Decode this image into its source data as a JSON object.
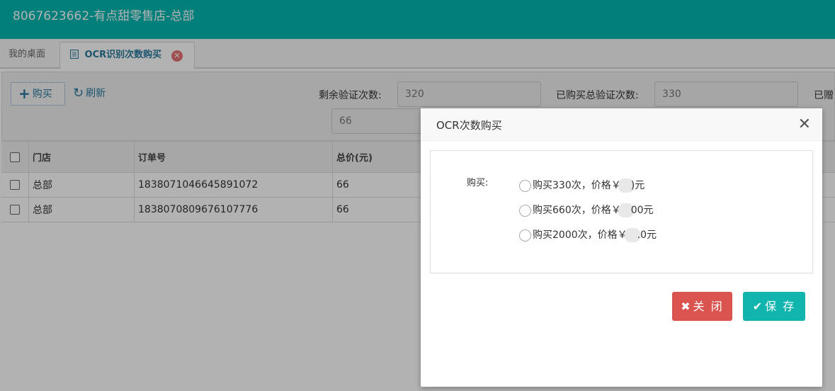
{
  "header": {
    "title": "8067623662-有点甜零售店-总部"
  },
  "tabs": [
    {
      "label": "我的桌面"
    },
    {
      "label": "OCR识别次数购买"
    }
  ],
  "toolbar": {
    "buy_label": "购买",
    "refresh_label": "刷新",
    "remaining_label": "剩余验证次数:",
    "remaining_value": "320",
    "total_label": "已购买总验证次数:",
    "total_value": "330",
    "gift_label": "已赠",
    "extra_value": "66"
  },
  "table": {
    "headers": [
      "门店",
      "订单号",
      "总价(元)"
    ],
    "rows": [
      {
        "store": "总部",
        "order": "1838071046645891072",
        "price": "66"
      },
      {
        "store": "总部",
        "order": "1838070809676107776",
        "price": "66"
      }
    ]
  },
  "dialog": {
    "title": "OCR次数购买",
    "buy_label": "购买:",
    "options": [
      {
        "prefix": "购买330次，价格￥",
        "suffix": ")元"
      },
      {
        "prefix": "购买660次，价格￥",
        "suffix": "00元"
      },
      {
        "prefix": "购买2000次，价格￥",
        "suffix": ".0元"
      }
    ],
    "close_label": "关 闭",
    "save_label": "保 存"
  },
  "colors": {
    "header": "#00b7b1",
    "accent": "#2a7a9e",
    "close_button": "#d9534f",
    "save_button": "#12b5ad"
  }
}
